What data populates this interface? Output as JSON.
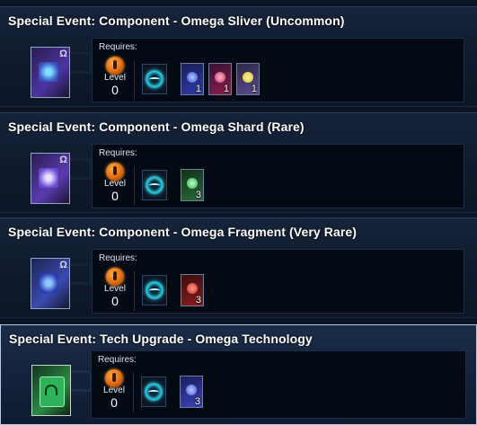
{
  "requires_label": "Requires:",
  "level_label": "Level",
  "omega_glyph": "Ω",
  "panels": [
    {
      "title": "Special Event: Component - Omega Sliver (Uncommon)",
      "reward_icon": "omega-sliver-icon",
      "accent": "#7a58d6",
      "level": "0",
      "materials": [
        {
          "icon": "blue-material-icon",
          "color": "#3d4fc8",
          "count": "1"
        },
        {
          "icon": "red-material-icon",
          "color": "#c83a6a",
          "count": "1"
        },
        {
          "icon": "yellow-material-icon",
          "color": "#d8c030",
          "count": "1"
        }
      ]
    },
    {
      "title": "Special Event: Component - Omega Shard (Rare)",
      "reward_icon": "omega-shard-icon",
      "accent": "#7a58d6",
      "level": "0",
      "materials": [
        {
          "icon": "green-material-icon",
          "color": "#3cae5c",
          "count": "3"
        }
      ]
    },
    {
      "title": "Special Event: Component - Omega Fragment (Very Rare)",
      "reward_icon": "omega-fragment-icon",
      "accent": "#5a6fd0",
      "level": "0",
      "materials": [
        {
          "icon": "red-material-icon",
          "color": "#c83030",
          "count": "3"
        }
      ]
    },
    {
      "title": "Special Event: Tech Upgrade - Omega Technology",
      "reward_icon": "omega-technology-icon",
      "accent": "#2fb35a",
      "level": "0",
      "materials": [
        {
          "icon": "blue-material-icon",
          "color": "#4a5adf",
          "count": "3"
        }
      ]
    }
  ]
}
